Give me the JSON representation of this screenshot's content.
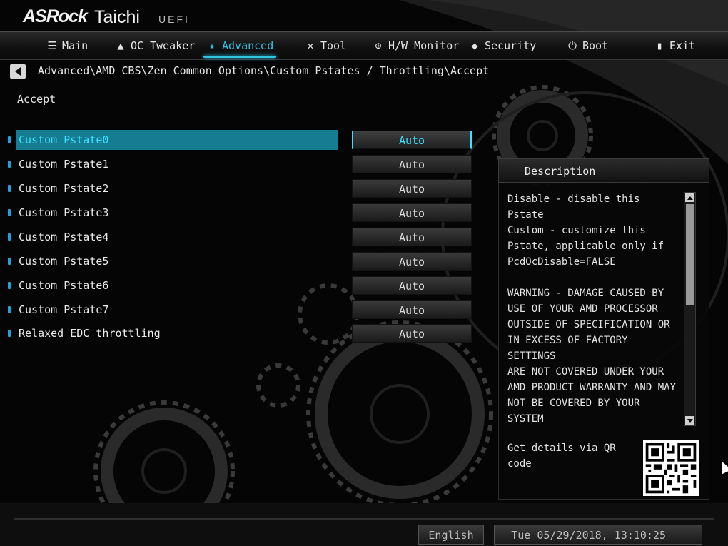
{
  "brand": {
    "logo": "ASRock",
    "model": "Taichi",
    "firmware": "UEFI"
  },
  "menu": {
    "tabs": [
      {
        "label": "Main",
        "icon": "list-icon"
      },
      {
        "label": "OC Tweaker",
        "icon": "rocket-icon"
      },
      {
        "label": "Advanced",
        "icon": "star-icon",
        "active": true
      },
      {
        "label": "Tool",
        "icon": "tools-icon"
      },
      {
        "label": "H/W Monitor",
        "icon": "crosshair-icon"
      },
      {
        "label": "Security",
        "icon": "shield-icon"
      },
      {
        "label": "Boot",
        "icon": "power-icon"
      },
      {
        "label": "Exit",
        "icon": "exit-icon"
      }
    ]
  },
  "breadcrumb": "Advanced\\AMD CBS\\Zen Common Options\\Custom Pstates / Throttling\\Accept",
  "page_title": "Accept",
  "settings": [
    {
      "label": "Custom Pstate0",
      "value": "Auto",
      "selected": true
    },
    {
      "label": "Custom Pstate1",
      "value": "Auto"
    },
    {
      "label": "Custom Pstate2",
      "value": "Auto"
    },
    {
      "label": "Custom Pstate3",
      "value": "Auto"
    },
    {
      "label": "Custom Pstate4",
      "value": "Auto"
    },
    {
      "label": "Custom Pstate5",
      "value": "Auto"
    },
    {
      "label": "Custom Pstate6",
      "value": "Auto"
    },
    {
      "label": "Custom Pstate7",
      "value": "Auto"
    },
    {
      "label": "Relaxed EDC throttling",
      "value": "Auto"
    }
  ],
  "description": {
    "title": "Description",
    "text": "Disable - disable this Pstate\nCustom - customize this\nPstate, applicable only if\nPcdOcDisable=FALSE\n\nWARNING - DAMAGE CAUSED BY\nUSE OF YOUR AMD PROCESSOR\nOUTSIDE OF SPECIFICATION OR\nIN EXCESS OF FACTORY SETTINGS\nARE NOT COVERED UNDER YOUR\nAMD PRODUCT WARRANTY AND MAY\nNOT BE COVERED BY YOUR SYSTEM\nMANUFACTURER'S WARRANTY.\nOperating your AMD processor\noutside of specification or",
    "qr_text": "Get details via QR code"
  },
  "footer": {
    "language": "English",
    "datetime": "Tue 05/29/2018, 13:10:25"
  },
  "colors": {
    "accent": "#2fc6e6",
    "selected_row": "#157c92",
    "selected_text": "#3ee0ff"
  }
}
